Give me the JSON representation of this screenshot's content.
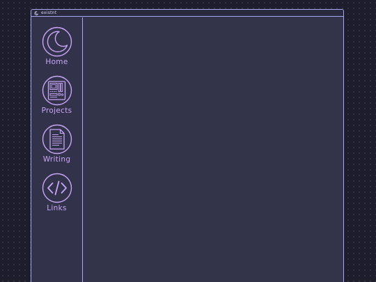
{
  "window": {
    "title": "existnt",
    "title_icon": "moon-icon"
  },
  "sidebar": {
    "items": [
      {
        "label": "Home",
        "icon": "moon-icon"
      },
      {
        "label": "Projects",
        "icon": "circuit-board-icon"
      },
      {
        "label": "Writing",
        "icon": "document-icon"
      },
      {
        "label": "Links",
        "icon": "code-brackets-icon"
      }
    ]
  },
  "colors": {
    "background": "#1e1d2b",
    "window_bg": "#32324a",
    "border": "#a9a6f5",
    "accent": "#c9a7f7"
  }
}
